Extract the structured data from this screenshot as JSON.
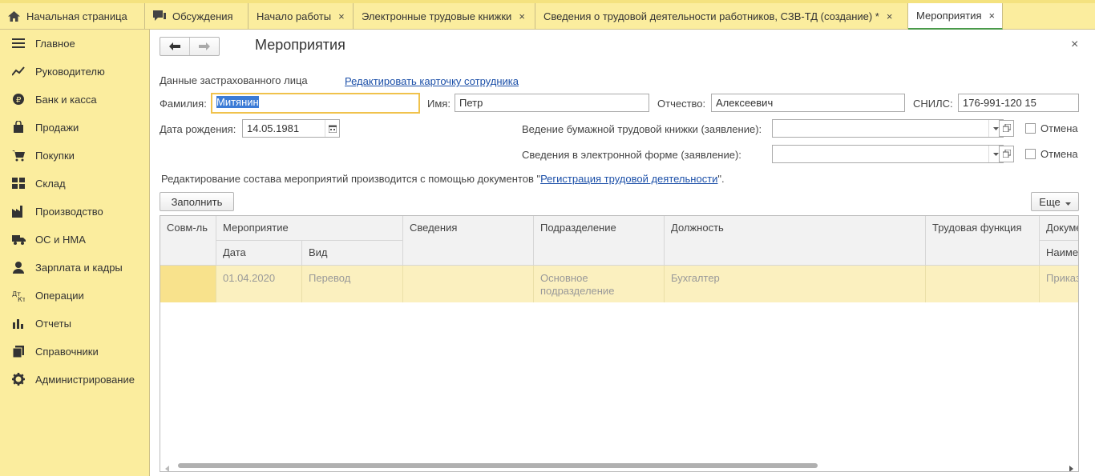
{
  "tabs": [
    {
      "label": "Начальная страница",
      "icon": "home-icon"
    },
    {
      "label": "Обсуждения",
      "icon": "chat-icon"
    },
    {
      "label": "Начало работы",
      "close": "×"
    },
    {
      "label": "Электронные трудовые книжки",
      "close": "×"
    },
    {
      "label": "Сведения о трудовой деятельности работников, СЗВ-ТД (создание) *",
      "close": "×"
    },
    {
      "label": "Мероприятия",
      "close": "×"
    }
  ],
  "sidebar": {
    "items": [
      {
        "label": "Главное",
        "icon": "menu-icon"
      },
      {
        "label": "Руководителю",
        "icon": "trend-chart-icon"
      },
      {
        "label": "Банк и касса",
        "icon": "ruble-coin-icon"
      },
      {
        "label": "Продажи",
        "icon": "shopping-bag-icon"
      },
      {
        "label": "Покупки",
        "icon": "cart-icon"
      },
      {
        "label": "Склад",
        "icon": "warehouse-grid-icon"
      },
      {
        "label": "Производство",
        "icon": "factory-icon"
      },
      {
        "label": "ОС и НМА",
        "icon": "truck-icon"
      },
      {
        "label": "Зарплата и кадры",
        "icon": "person-icon"
      },
      {
        "label": "Операции",
        "icon": "debit-credit-icon"
      },
      {
        "label": "Отчеты",
        "icon": "bar-chart-icon"
      },
      {
        "label": "Справочники",
        "icon": "books-icon"
      },
      {
        "label": "Администрирование",
        "icon": "gear-icon"
      }
    ]
  },
  "form": {
    "title": "Мероприятия",
    "close": "×",
    "section_label": "Данные застрахованного лица",
    "edit_link": "Редактировать карточку сотрудника",
    "surname_label": "Фамилия:",
    "surname_value": "Митянин",
    "name_label": "Имя:",
    "name_value": "Петр",
    "patronymic_label": "Отчество:",
    "patronymic_value": "Алексеевич",
    "snils_label": "СНИЛС:",
    "snils_value": "176-991-120 15",
    "birthdate_label": "Дата рождения:",
    "birthdate_value": "14.05.1981",
    "paper_book_label": "Ведение бумажной трудовой книжки (заявление):",
    "paper_book_value": "",
    "electronic_label": "Сведения в электронной форме (заявление):",
    "electronic_value": "",
    "cancel_label": "Отмена",
    "info_prefix": "Редактирование состава мероприятий производится с помощью документов \"",
    "info_link": "Регистрация трудовой деятельности",
    "info_suffix": "\".",
    "fill_button": "Заполнить",
    "more_button": "Еще"
  },
  "table": {
    "headers": {
      "combo": "Совм-ль",
      "event": "Мероприятие",
      "date": "Дата",
      "kind": "Вид",
      "info": "Сведения",
      "division": "Подразделение",
      "position": "Должность",
      "labor_function": "Трудовая функция",
      "document": "Документ",
      "doc_name": "Наименование"
    },
    "rows": [
      {
        "combo": "",
        "date": "01.04.2020",
        "kind": "Перевод",
        "info": "",
        "division_line1": "Основное",
        "division_line2": "подразделение",
        "position": "Бухгалтер",
        "labor_function": "",
        "document": "Приказ"
      }
    ]
  },
  "colors": {
    "accent_bg": "#fbed9e",
    "row_highlight": "#fbf0bf",
    "focus_border": "#f0c24c",
    "link": "#1b4fa8",
    "active_tab_underline": "#4a9a4a"
  }
}
